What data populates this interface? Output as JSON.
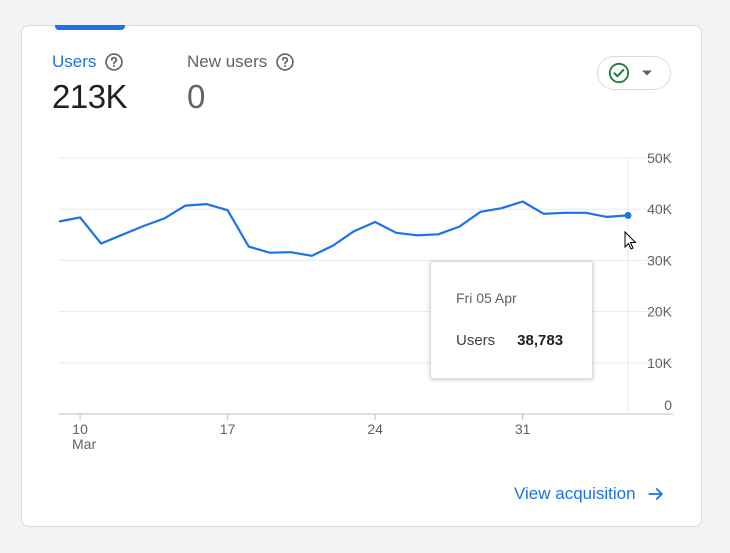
{
  "metrics": {
    "users": {
      "label": "Users",
      "value": "213K"
    },
    "new_users": {
      "label": "New users",
      "value": "0"
    }
  },
  "compare_button": {
    "icon": "check-circle-icon",
    "dropdown_icon": "caret-down-icon"
  },
  "chart_data": {
    "type": "line",
    "title": "",
    "xlabel": "",
    "ylabel": "",
    "x": [
      "Mar 9",
      "Mar 10",
      "Mar 11",
      "Mar 12",
      "Mar 13",
      "Mar 14",
      "Mar 15",
      "Mar 16",
      "Mar 17",
      "Mar 18",
      "Mar 19",
      "Mar 20",
      "Mar 21",
      "Mar 22",
      "Mar 23",
      "Mar 24",
      "Mar 25",
      "Mar 26",
      "Mar 27",
      "Mar 28",
      "Mar 29",
      "Mar 30",
      "Mar 31",
      "Apr 1",
      "Apr 2",
      "Apr 3",
      "Apr 4",
      "Apr 5"
    ],
    "series": [
      {
        "name": "Users",
        "color": "#1a73e8",
        "values": [
          37600,
          38400,
          33300,
          35000,
          36700,
          38200,
          40700,
          41000,
          39800,
          32700,
          31500,
          31600,
          30900,
          32900,
          35700,
          37500,
          35400,
          34900,
          35100,
          36600,
          39500,
          40200,
          41500,
          39100,
          39300,
          39300,
          38500,
          38783
        ]
      }
    ],
    "x_ticks": [
      {
        "label": "10",
        "sublabel": "Mar",
        "index": 1
      },
      {
        "label": "17",
        "sublabel": "",
        "index": 8
      },
      {
        "label": "24",
        "sublabel": "",
        "index": 15
      },
      {
        "label": "31",
        "sublabel": "",
        "index": 22
      }
    ],
    "y_ticks": [
      "0",
      "10K",
      "20K",
      "30K",
      "40K",
      "50K"
    ],
    "y_tick_values": [
      0,
      10000,
      20000,
      30000,
      40000,
      50000
    ],
    "ylim": [
      0,
      50000
    ],
    "grid": true,
    "y_axis_position": "right"
  },
  "tooltip": {
    "date": "Fri 05 Apr",
    "series_label": "Users",
    "value": "38,783"
  },
  "view_link": {
    "label": "View acquisition",
    "icon": "arrow-right-icon"
  },
  "colors": {
    "accent": "#1a73e8",
    "check": "#188038"
  }
}
